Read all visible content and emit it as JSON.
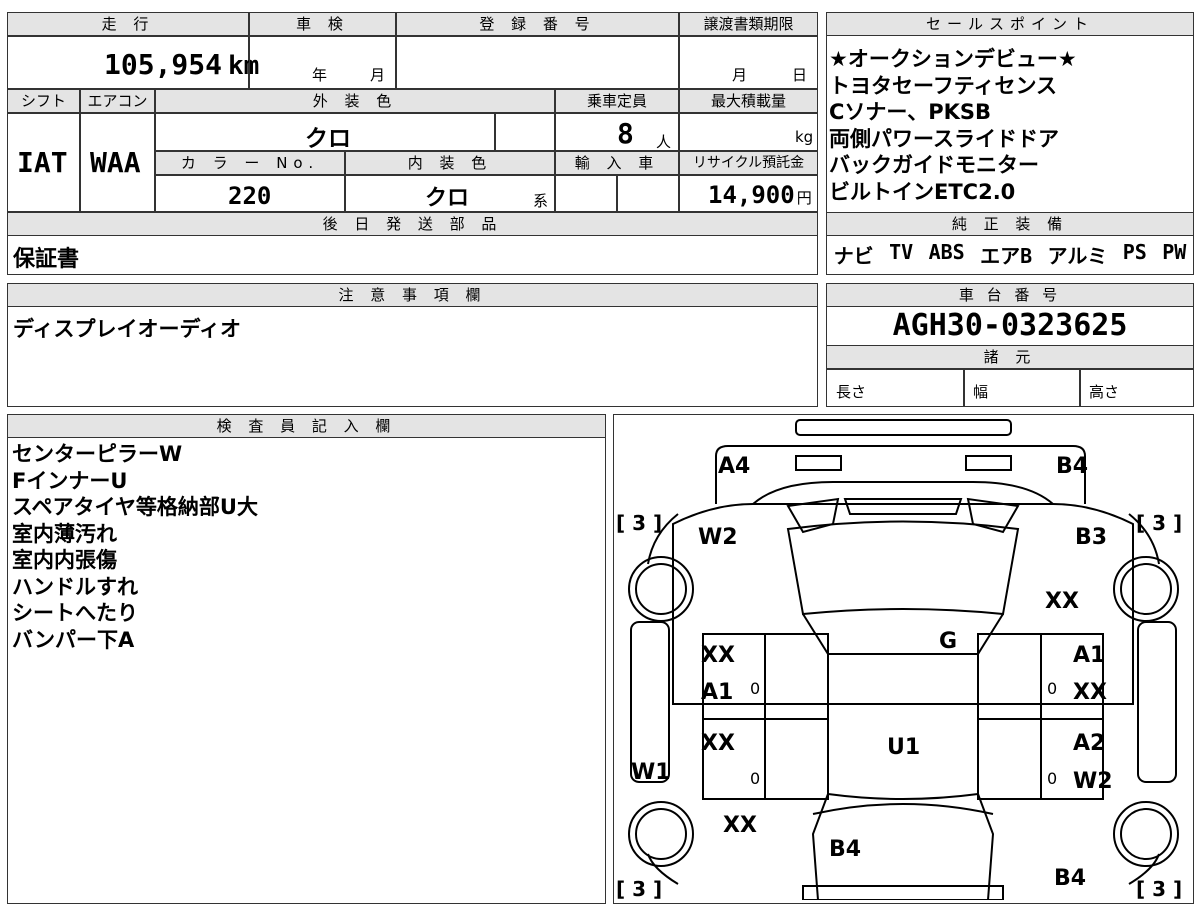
{
  "headers": {
    "mileage": "走 行",
    "shaken": "車 検",
    "registration": "登 録 番 号",
    "transfer_deadline": "譲渡書類期限",
    "sales_points": "セールスポイント",
    "shift": "シフト",
    "aircon": "エアコン",
    "exterior_color": "外 装 色",
    "capacity": "乗車定員",
    "max_load": "最大積載量",
    "color_no": "カ ラ ー No.",
    "interior_color": "内 装 色",
    "import": "輸 入 車",
    "recycle_fee": "リサイクル預託金",
    "later_parts": "後 日 発 送 部 品",
    "genuine_equipment": "純 正 装 備",
    "notes": "注 意 事 項 欄",
    "chassis_number": "車 台 番 号",
    "specs": "諸 元",
    "inspector": "検 査 員 記 入 欄"
  },
  "vehicle": {
    "mileage_value": "105,954",
    "mileage_unit": "km",
    "shaken_year": "年",
    "shaken_month": "月",
    "deadline_month": "月",
    "deadline_day": "日",
    "shift": "IAT",
    "aircon": "WAA",
    "exterior_color": "クロ",
    "capacity_value": "8",
    "capacity_unit": "人",
    "load_unit": "kg",
    "color_no": "220",
    "interior_color": "クロ",
    "interior_suffix": "系",
    "recycle_value": "14,900",
    "recycle_unit": "円",
    "later_parts": "保証書",
    "chassis_number": "AGH30-0323625",
    "spec_length": "長さ",
    "spec_width": "幅",
    "spec_height": "高さ"
  },
  "sales_points": [
    "★オークションデビュー★",
    "トヨタセーフティセンス",
    "Cソナー、PKSB",
    "両側パワースライドドア",
    "バックガイドモニター",
    "ビルトインETC2.0"
  ],
  "genuine_equipment": [
    "ナビ",
    "TV",
    "ABS",
    "エアB",
    "アルミ",
    "PS",
    "PW"
  ],
  "notes": "ディスプレイオーディオ",
  "inspector_notes": [
    "センターピラーW",
    "FインナーU",
    "スペアタイヤ等格納部U大",
    "室内薄汚れ",
    "室内内張傷",
    "ハンドルすれ",
    "シートへたり",
    "バンパー下A"
  ],
  "diagram": {
    "marks": {
      "A4": "A4",
      "B4_top": "B4",
      "W2_left": "W2",
      "B3": "B3",
      "XX_right_front": "XX",
      "G": "G",
      "XX_lf1": "XX",
      "A1_lf": "A1",
      "A1_rf": "A1",
      "XX_rf": "XX",
      "XX_lr": "XX",
      "U1": "U1",
      "A2": "A2",
      "W2_rr": "W2",
      "W1": "W1",
      "XX_rear_wheel": "XX",
      "B4_rear": "B4",
      "B4_rear_right": "B4"
    },
    "tread": {
      "tl": "[ 3 ]",
      "tr": "[ 3 ]",
      "bl": "[ 3 ]",
      "br": "[ 3 ]"
    },
    "zeros": [
      "0",
      "0",
      "0",
      "0"
    ]
  }
}
